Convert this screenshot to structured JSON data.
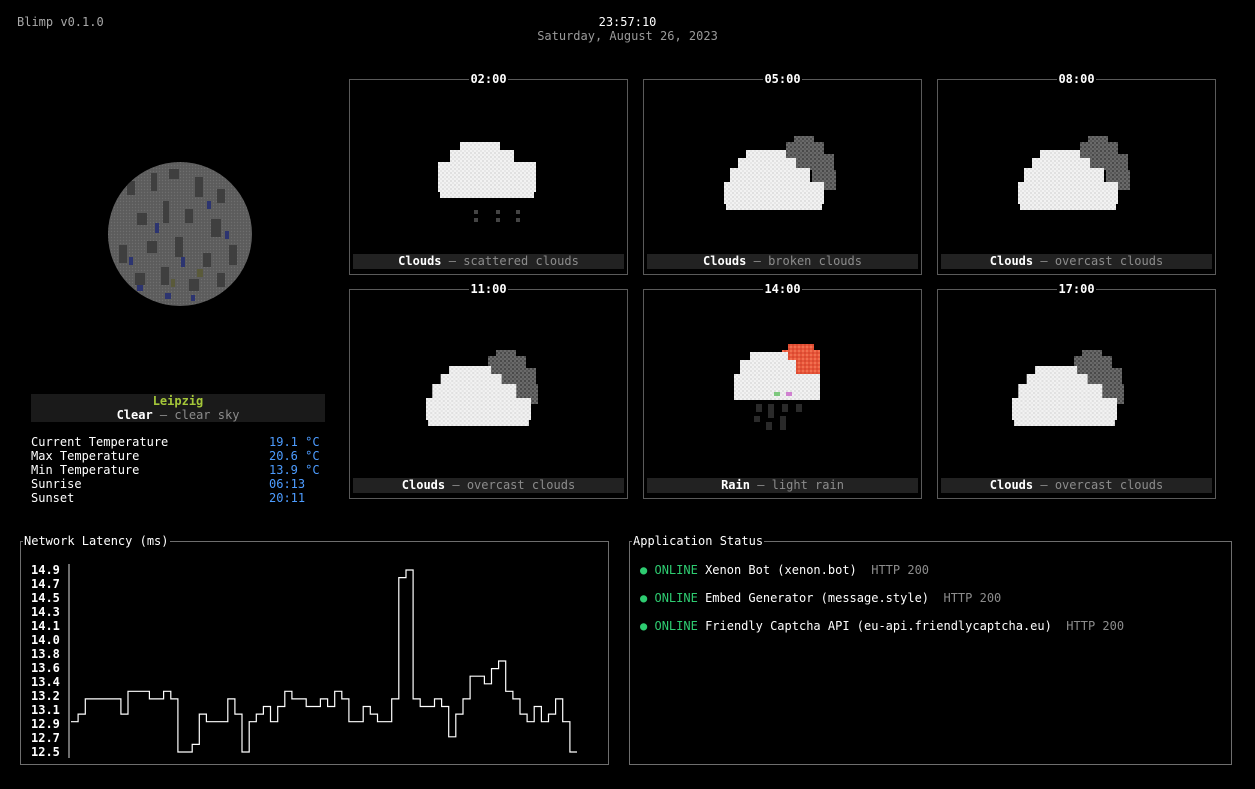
{
  "header": {
    "app_name": "Blimp v0.1.0",
    "time": "23:57:10",
    "date": "Saturday, August 26, 2023"
  },
  "weather": {
    "city": "Leipzig",
    "condition_main": "Clear",
    "condition_sep": " – ",
    "condition_desc": "clear sky",
    "stats": [
      {
        "label": "Current Temperature",
        "value": "19.1 °C"
      },
      {
        "label": "Max Temperature",
        "value": "20.6 °C"
      },
      {
        "label": "Min Temperature",
        "value": "13.9 °C"
      },
      {
        "label": "Sunrise",
        "value": "06:13"
      },
      {
        "label": "Sunset",
        "value": "20:11"
      }
    ]
  },
  "forecast": [
    {
      "time": "02:00",
      "main": "Clouds",
      "sep": " – ",
      "desc": "scattered clouds",
      "icon": "cloud-drizzle-icon"
    },
    {
      "time": "05:00",
      "main": "Clouds",
      "sep": " – ",
      "desc": "broken clouds",
      "icon": "broken-clouds-icon"
    },
    {
      "time": "08:00",
      "main": "Clouds",
      "sep": " – ",
      "desc": "overcast clouds",
      "icon": "overcast-clouds-icon"
    },
    {
      "time": "11:00",
      "main": "Clouds",
      "sep": " – ",
      "desc": "overcast clouds",
      "icon": "overcast-clouds-icon"
    },
    {
      "time": "14:00",
      "main": "Rain",
      "sep": " – ",
      "desc": "light rain",
      "icon": "sun-rain-icon"
    },
    {
      "time": "17:00",
      "main": "Clouds",
      "sep": " – ",
      "desc": "overcast clouds",
      "icon": "overcast-clouds-icon"
    }
  ],
  "latency": {
    "title": "Network Latency (ms)",
    "y_ticks": [
      "14.9",
      "14.7",
      "14.5",
      "14.3",
      "14.1",
      "14.0",
      "13.8",
      "13.6",
      "13.4",
      "13.2",
      "13.1",
      "12.9",
      "12.7",
      "12.5"
    ]
  },
  "chart_data": {
    "type": "line",
    "title": "Network Latency (ms)",
    "ylim": [
      12.5,
      14.9
    ],
    "series": [
      {
        "values": [
          12.9,
          13.0,
          13.2,
          13.2,
          13.2,
          13.2,
          13.2,
          13.0,
          13.3,
          13.3,
          13.3,
          13.2,
          13.2,
          13.3,
          13.2,
          12.5,
          12.5,
          12.6,
          13.0,
          12.9,
          12.9,
          12.9,
          13.2,
          13.0,
          12.5,
          12.9,
          13.0,
          13.1,
          12.9,
          13.1,
          13.3,
          13.2,
          13.2,
          13.1,
          13.1,
          13.2,
          13.1,
          13.3,
          13.2,
          12.9,
          12.9,
          13.1,
          13.0,
          12.9,
          12.9,
          13.2,
          14.8,
          14.9,
          13.2,
          13.1,
          13.1,
          13.2,
          13.1,
          12.7,
          13.0,
          13.2,
          13.5,
          13.5,
          13.4,
          13.6,
          13.7,
          13.3,
          13.2,
          13.0,
          12.9,
          13.1,
          12.9,
          13.0,
          13.2,
          12.9,
          12.5
        ]
      }
    ],
    "grid": false
  },
  "status": {
    "title": "Application Status",
    "apps": [
      {
        "dot": "●",
        "state": "ONLINE",
        "name": "Xenon Bot (xenon.bot)",
        "code": "HTTP 200"
      },
      {
        "dot": "●",
        "state": "ONLINE",
        "name": "Embed Generator (message.style)",
        "code": "HTTP 200"
      },
      {
        "dot": "●",
        "state": "ONLINE",
        "name": "Friendly Captcha API (eu-api.friendlycaptcha.eu)",
        "code": "HTTP 200"
      }
    ]
  },
  "colors": {
    "accent_city": "#a4c639",
    "value_blue": "#4d9cff",
    "online_green": "#2ecc71"
  }
}
